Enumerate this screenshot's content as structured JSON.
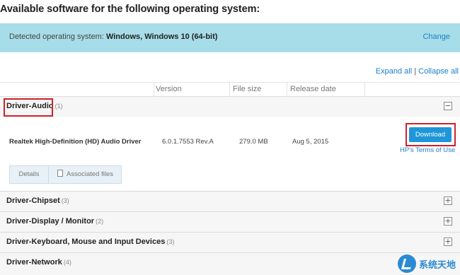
{
  "page": {
    "title": "Available software for the following operating system:"
  },
  "os_banner": {
    "label": "Detected operating system:",
    "value": "Windows, Windows 10 (64-bit)",
    "change_label": "Change"
  },
  "expand": {
    "expand_label": "Expand all",
    "separator": "|",
    "collapse_label": "Collapse all"
  },
  "table": {
    "headers": [
      "Version",
      "File size",
      "Release date"
    ]
  },
  "sections": [
    {
      "name": "Driver-Audio",
      "count": "(1)",
      "expanded": true,
      "toggle": "−"
    },
    {
      "name": "Driver-Chipset",
      "count": "(3)",
      "expanded": false,
      "toggle": "+"
    },
    {
      "name": "Driver-Display / Monitor",
      "count": "(2)",
      "expanded": false,
      "toggle": "+"
    },
    {
      "name": "Driver-Keyboard, Mouse and Input Devices",
      "count": "(3)",
      "expanded": false,
      "toggle": "+"
    },
    {
      "name": "Driver-Network",
      "count": "(4)",
      "expanded": false,
      "toggle": "+"
    }
  ],
  "driver": {
    "name": "Realtek High-Definition (HD) Audio Driver",
    "version": "6.0.1.7553 Rev.A",
    "file_size": "279.0 MB",
    "release_date": "Aug 5, 2015",
    "download_label": "Download",
    "terms_label": "HP's Terms of Use",
    "tabs": [
      "Details",
      "Associated files"
    ]
  },
  "watermark": {
    "text": "系统天地"
  },
  "colors": {
    "banner_bg": "#a7dde8",
    "link": "#1a7fc7",
    "download_bg": "#1f96d8",
    "highlight_red": "#d0202a"
  }
}
